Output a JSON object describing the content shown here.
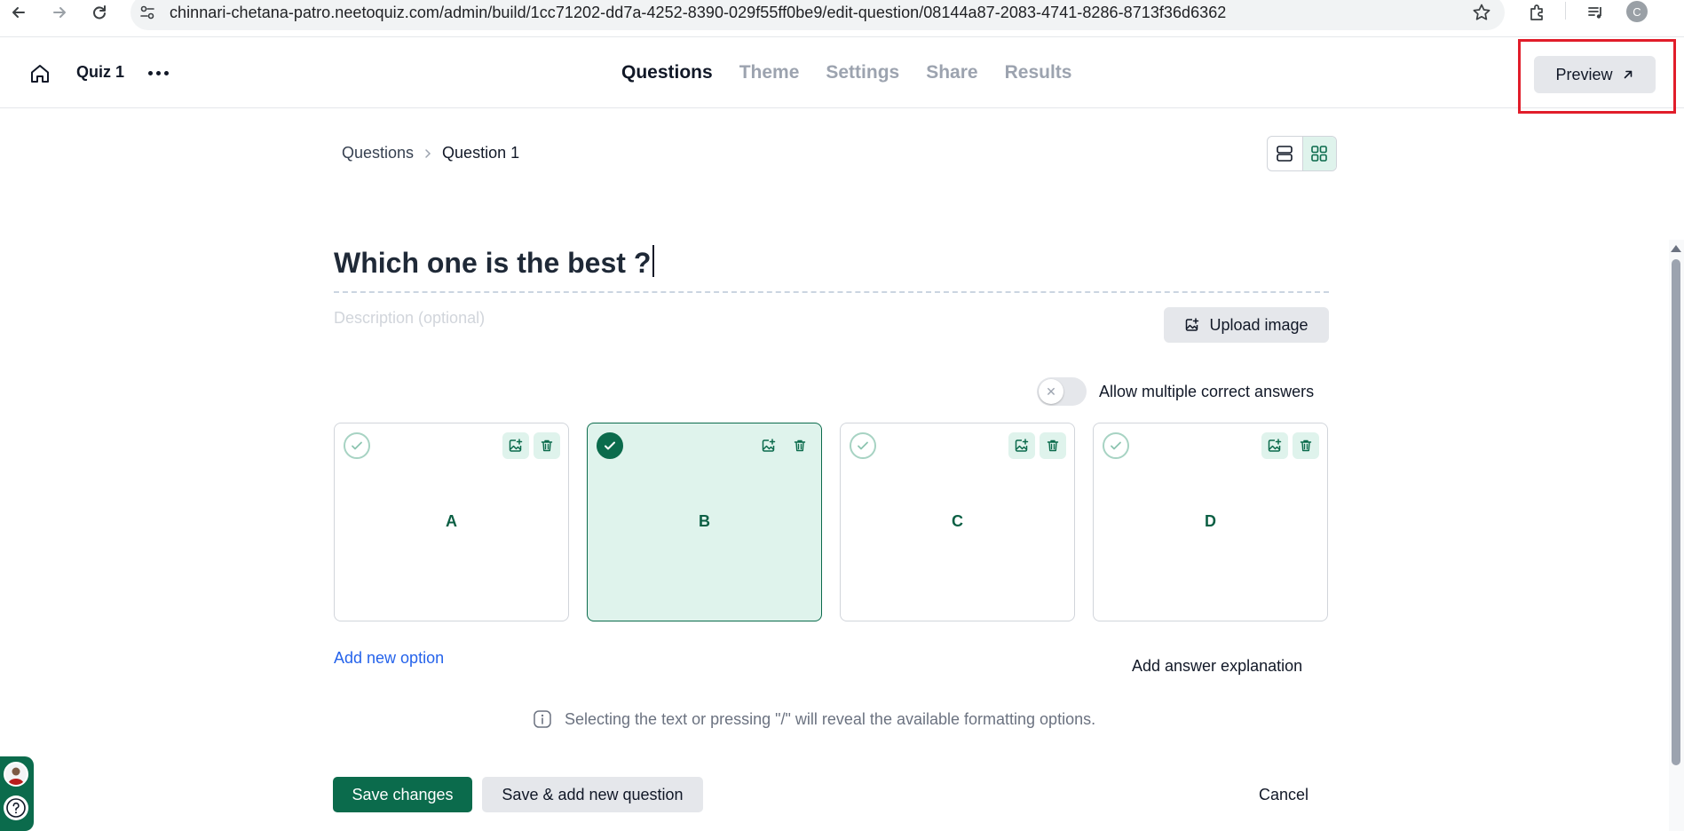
{
  "browser": {
    "url": "chinnari-chetana-patro.neetoquiz.com/admin/build/1cc71202-dd7a-4252-8390-029f55ff0be9/edit-question/08144a87-2083-4741-8286-8713f36d6362",
    "profile_initial": "C"
  },
  "header": {
    "quiz_title": "Quiz 1",
    "tabs": [
      {
        "label": "Questions",
        "active": true
      },
      {
        "label": "Theme",
        "active": false
      },
      {
        "label": "Settings",
        "active": false
      },
      {
        "label": "Share",
        "active": false
      },
      {
        "label": "Results",
        "active": false
      }
    ],
    "preview_label": "Preview"
  },
  "breadcrumb": {
    "parent": "Questions",
    "current": "Question 1"
  },
  "question": {
    "title": "Which one is the best ?",
    "description_placeholder": "Description (optional)",
    "upload_image_label": "Upload image",
    "multiple_answers_label": "Allow multiple correct answers",
    "multiple_answers_enabled": false
  },
  "options": [
    {
      "label": "A",
      "correct": false
    },
    {
      "label": "B",
      "correct": true
    },
    {
      "label": "C",
      "correct": false
    },
    {
      "label": "D",
      "correct": false
    }
  ],
  "actions": {
    "add_option": "Add new option",
    "add_explanation": "Add answer explanation",
    "hint": "Selecting the text or pressing \"/\" will reveal the available formatting options.",
    "save": "Save changes",
    "save_add": "Save & add new question",
    "cancel": "Cancel"
  },
  "colors": {
    "accent": "#0b6b4c",
    "accent_light": "#dff3ec",
    "highlight_border": "#e11d2a",
    "link": "#2563eb"
  }
}
